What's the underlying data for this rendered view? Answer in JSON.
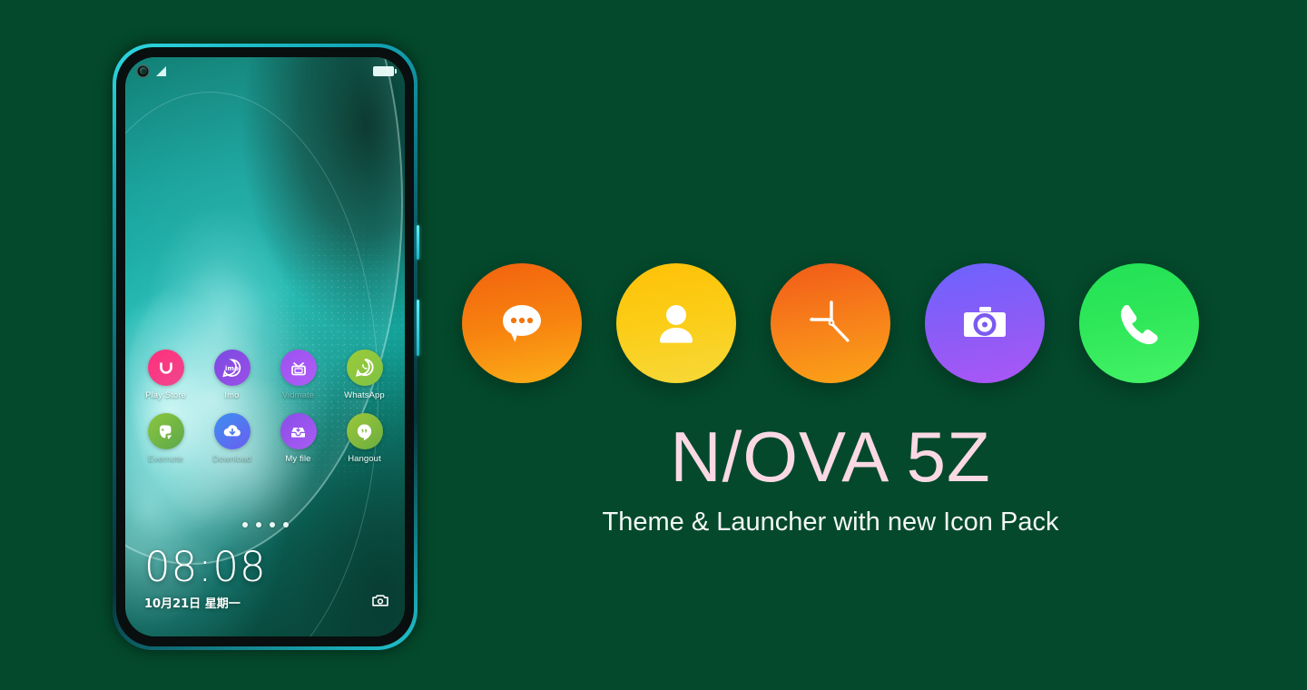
{
  "theme": {
    "background_color": "#04492c",
    "title_color": "#fbd9e4",
    "subtitle_color": "#f3f7f5"
  },
  "hero": {
    "title": "N/OVA 5Z",
    "subtitle": "Theme & Launcher with new Icon Pack"
  },
  "icon_showcase": [
    {
      "name": "messages-icon",
      "label": "Messages",
      "color_start": "#f2620f",
      "color_end": "#fca311"
    },
    {
      "name": "contacts-icon",
      "label": "Contacts",
      "color_start": "#ffc107",
      "color_end": "#f9d423"
    },
    {
      "name": "clock-icon",
      "label": "Clock",
      "color_start": "#f15a18",
      "color_end": "#fb9b18"
    },
    {
      "name": "camera-icon",
      "label": "Camera",
      "color_start": "#6c63ff",
      "color_end": "#a855f7"
    },
    {
      "name": "phone-icon",
      "label": "Phone",
      "color_start": "#22e055",
      "color_end": "#3ef05f"
    }
  ],
  "phone": {
    "status_bar": {
      "punch_hole": "front-camera",
      "signal": "signal-bars-icon",
      "battery": "battery-icon"
    },
    "apps": [
      {
        "label": "Play Store",
        "icon": "play-store-icon",
        "color_start": "#ff2f7b",
        "color_end": "#f0478e",
        "dim": false
      },
      {
        "label": "Imo",
        "icon": "imo-icon",
        "color_start": "#7b4ae0",
        "color_end": "#9b4fe8",
        "dim": false
      },
      {
        "label": "Vidmate",
        "icon": "tv-icon",
        "color_start": "#9a52f0",
        "color_end": "#b15cf5",
        "dim": true
      },
      {
        "label": "WhatsApp",
        "icon": "whatsapp-icon",
        "color_start": "#9ccb3b",
        "color_end": "#7ec242",
        "dim": false
      },
      {
        "label": "Evernote",
        "icon": "evernote-icon",
        "color_start": "#8cc63f",
        "color_end": "#5ba84a",
        "dim": true
      },
      {
        "label": "Download",
        "icon": "download-icon",
        "color_start": "#3b8ff0",
        "color_end": "#6b5ef0",
        "dim": true
      },
      {
        "label": "My file",
        "icon": "my-file-icon",
        "color_start": "#8a4ce8",
        "color_end": "#a95df2",
        "dim": false
      },
      {
        "label": "Hangout",
        "icon": "hangout-icon",
        "color_start": "#9dc83c",
        "color_end": "#6aad3e",
        "dim": false
      }
    ],
    "page_dots": {
      "count": 4,
      "active_index": 0
    },
    "lockscreen": {
      "time": "08:08",
      "date": "10月21日 星期一",
      "camera_shortcut": "camera-shortcut-icon"
    },
    "side_buttons": [
      "power-button",
      "volume-button"
    ]
  }
}
